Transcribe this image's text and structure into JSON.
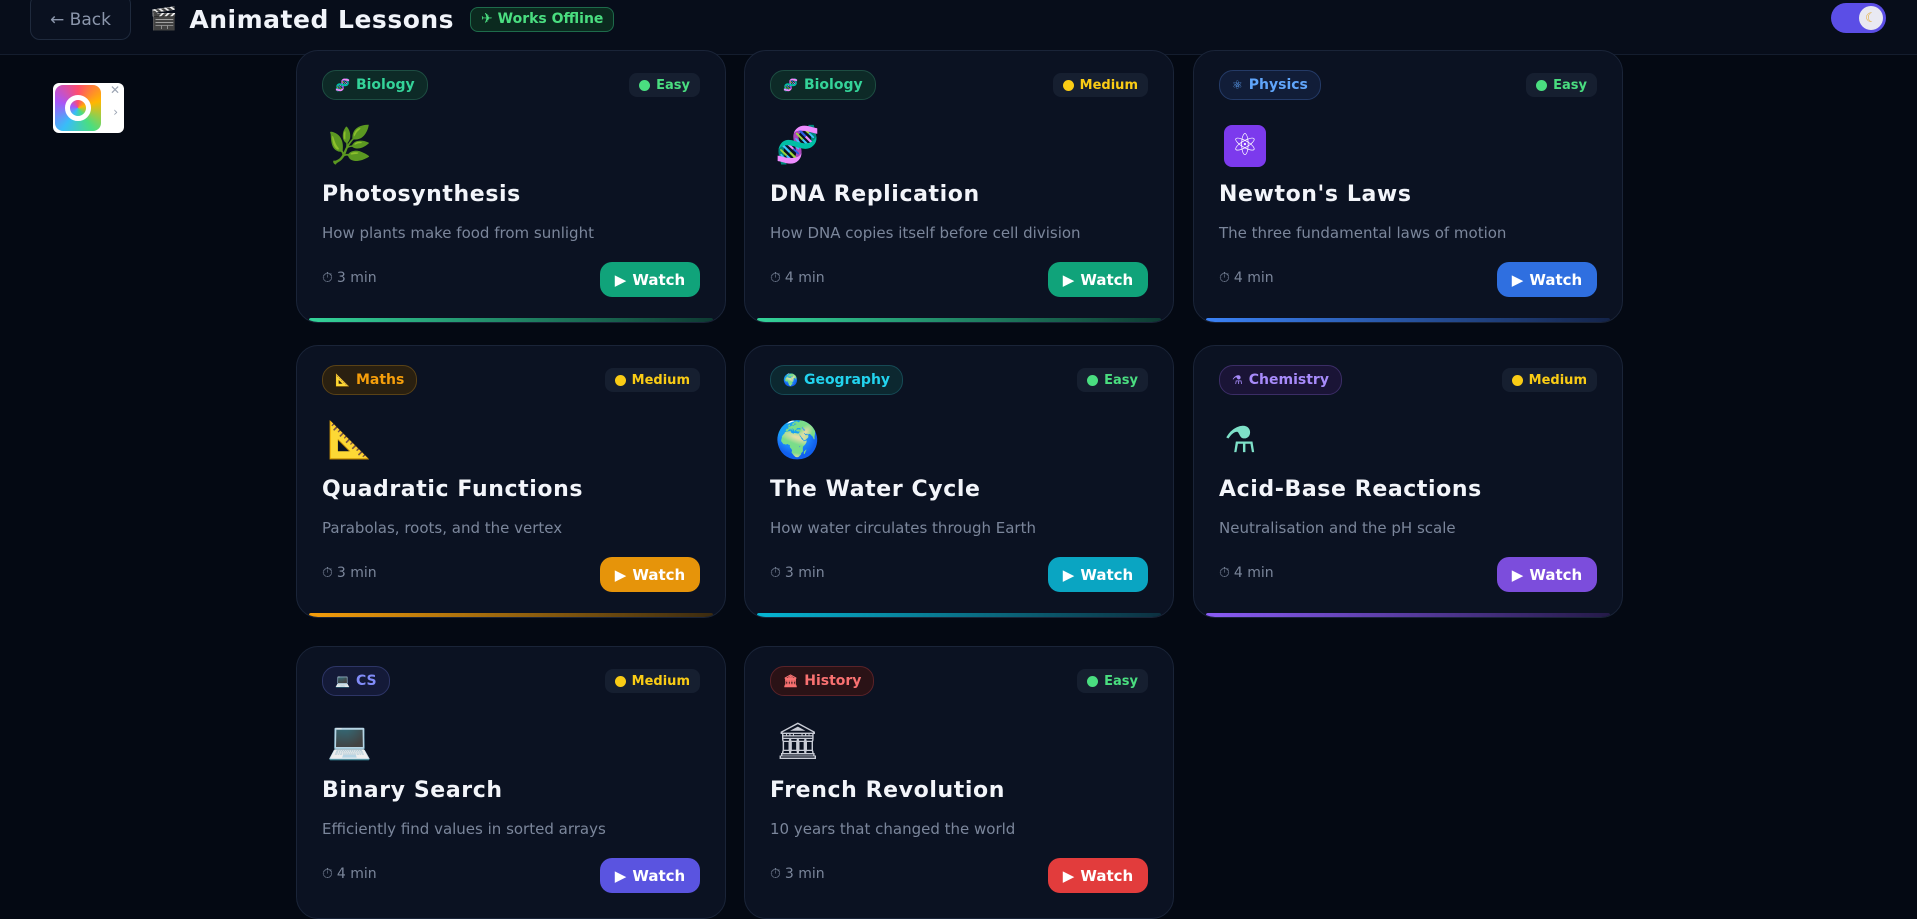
{
  "header": {
    "back_label": "← Back",
    "title_icon": "clapper-icon",
    "title": "Animated Lessons",
    "offline_badge": "✈ Works Offline",
    "theme_toggle_icon": "moon-icon"
  },
  "lessons": [
    {
      "subject": "Biology",
      "subject_icon": "dna-icon",
      "difficulty": "Easy",
      "icon": "🌿",
      "icon_name": "herb-icon",
      "title": "Photosynthesis",
      "desc": "How plants make food from sunlight",
      "duration": "3 min",
      "watch": "Watch"
    },
    {
      "subject": "Biology",
      "subject_icon": "dna-icon",
      "difficulty": "Medium",
      "icon": "🧬",
      "icon_name": "dna-icon",
      "title": "DNA Replication",
      "desc": "How DNA copies itself before cell division",
      "duration": "4 min",
      "watch": "Watch"
    },
    {
      "subject": "Physics",
      "subject_icon": "atom-icon",
      "difficulty": "Easy",
      "icon": "⚛",
      "icon_name": "atom-icon",
      "title": "Newton's Laws",
      "desc": "The three fundamental laws of motion",
      "duration": "4 min",
      "watch": "Watch"
    },
    {
      "subject": "Maths",
      "subject_icon": "triangle-ruler-icon",
      "difficulty": "Medium",
      "icon": "📐",
      "icon_name": "triangle-ruler-icon",
      "title": "Quadratic Functions",
      "desc": "Parabolas, roots, and the vertex",
      "duration": "3 min",
      "watch": "Watch"
    },
    {
      "subject": "Geography",
      "subject_icon": "globe-icon",
      "difficulty": "Easy",
      "icon": "🌍",
      "icon_name": "globe-icon",
      "title": "The Water Cycle",
      "desc": "How water circulates through Earth",
      "duration": "3 min",
      "watch": "Watch"
    },
    {
      "subject": "Chemistry",
      "subject_icon": "flask-icon",
      "difficulty": "Medium",
      "icon": "⚗",
      "icon_name": "flask-icon",
      "title": "Acid-Base Reactions",
      "desc": "Neutralisation and the pH scale",
      "duration": "4 min",
      "watch": "Watch"
    },
    {
      "subject": "CS",
      "subject_icon": "laptop-icon",
      "difficulty": "Medium",
      "icon": "💻",
      "icon_name": "laptop-icon",
      "title": "Binary Search",
      "desc": "Efficiently find values in sorted arrays",
      "duration": "4 min",
      "watch": "Watch"
    },
    {
      "subject": "History",
      "subject_icon": "classical-building-icon",
      "difficulty": "Easy",
      "icon": "🏛",
      "icon_name": "classical-building-icon",
      "title": "French Revolution",
      "desc": "10 years that changed the world",
      "duration": "3 min",
      "watch": "Watch"
    }
  ],
  "colors": {
    "biology": "#34d399",
    "physics": "#3b82f6",
    "maths": "#f59e0b",
    "geography": "#06b6d4",
    "chemistry": "#8b5cf6",
    "cs": "#6366f1",
    "history": "#ef4444",
    "easy": "#4ade80",
    "medium": "#facc15"
  }
}
